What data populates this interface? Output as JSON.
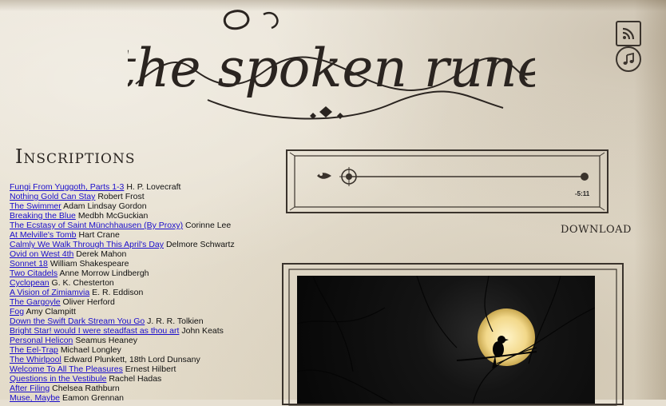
{
  "site": {
    "logo_text": "the spoken rune"
  },
  "header": {
    "rss_icon": "rss-icon",
    "music_icon": "music-note-icon"
  },
  "inscriptions": {
    "title": "Inscriptions",
    "items": [
      {
        "title": "Fungi From Yuggoth, Parts 1-3",
        "author": "H. P. Lovecraft"
      },
      {
        "title": "Nothing Gold Can Stay",
        "author": "Robert Frost"
      },
      {
        "title": "The Swimmer",
        "author": "Adam Lindsay Gordon"
      },
      {
        "title": "Breaking the Blue",
        "author": "Medbh McGuckian"
      },
      {
        "title": "The Ecstasy of Saint Münchhausen (By Proxy)",
        "author": "Corinne Lee"
      },
      {
        "title": "At Melville's Tomb",
        "author": "Hart Crane"
      },
      {
        "title": "Calmly We Walk Through This April's Day",
        "author": "Delmore Schwartz"
      },
      {
        "title": "Ovid on West 4th",
        "author": "Derek Mahon"
      },
      {
        "title": "Sonnet 18",
        "author": "William Shakespeare"
      },
      {
        "title": "Two Citadels",
        "author": "Anne Morrow Lindbergh"
      },
      {
        "title": "Cyclopean",
        "author": "G. K. Chesterton"
      },
      {
        "title": "A Vision of Zimiamvia",
        "author": "E. R. Eddison"
      },
      {
        "title": "The Gargoyle",
        "author": "Oliver Herford"
      },
      {
        "title": "Fog",
        "author": "Amy Clampitt"
      },
      {
        "title": "Down the Swift Dark Stream You Go",
        "author": "J. R. R. Tolkien"
      },
      {
        "title": "Bright Star! would I were steadfast as thou art",
        "author": "John Keats"
      },
      {
        "title": "Personal Helicon",
        "author": "Seamus Heaney"
      },
      {
        "title": "The Eel-Trap",
        "author": "Michael Longley"
      },
      {
        "title": "The Whirlpool",
        "author": "Edward Plunkett, 18th Lord Dunsany"
      },
      {
        "title": "Welcome To All The Pleasures",
        "author": "Ernest Hilbert"
      },
      {
        "title": "Questions in the Vestibule",
        "author": "Rachel Hadas"
      },
      {
        "title": "After Filing",
        "author": "Chelsea Rathburn"
      },
      {
        "title": "Muse, Maybe",
        "author": "Eamon Grennan"
      }
    ]
  },
  "player": {
    "progress": 0.0,
    "time_remaining": "-5:11",
    "download_label": "Download"
  }
}
